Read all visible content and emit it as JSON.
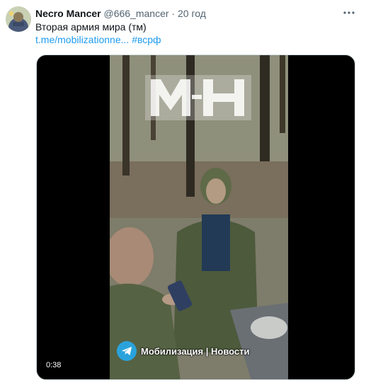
{
  "tweet": {
    "author_name": "Necro Mancer",
    "handle": "@666_mancer",
    "separator": "·",
    "time": "20 год",
    "text": "Вторая армия мира (тм)",
    "link": "t.me/mobilizationne...",
    "hashtag": "#всрф",
    "more_icon": "more-horizontal-icon"
  },
  "video": {
    "duration": "0:38",
    "watermark_icon": "mn-watermark-logo",
    "channel_icon": "telegram-icon",
    "channel_label": "Мобилизация | Новости"
  },
  "colors": {
    "link": "#1d9bf0",
    "secondary_text": "#536471",
    "telegram": "#2aa3dc"
  }
}
